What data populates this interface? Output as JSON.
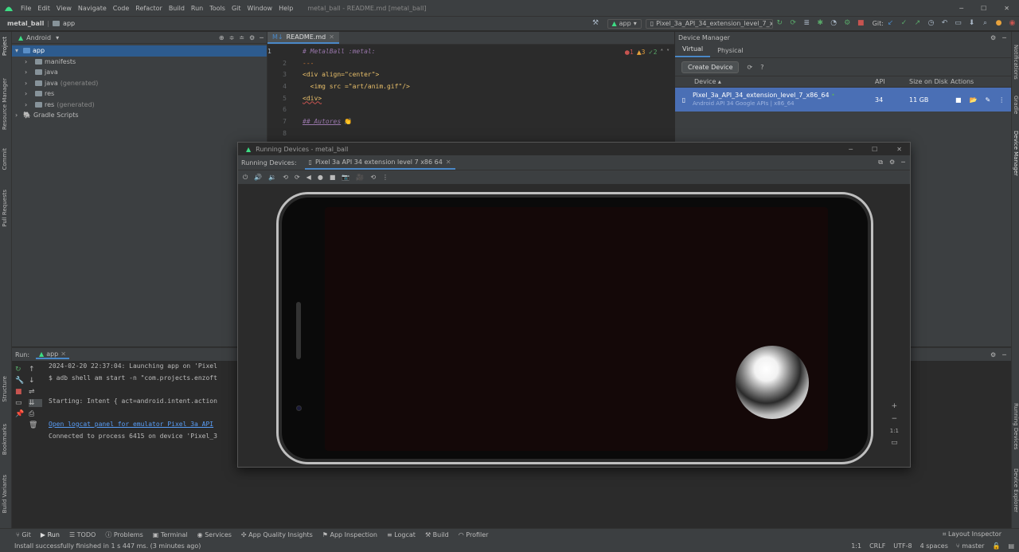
{
  "menu": [
    "File",
    "Edit",
    "View",
    "Navigate",
    "Code",
    "Refactor",
    "Build",
    "Run",
    "Tools",
    "Git",
    "Window",
    "Help"
  ],
  "window_title": "metal_ball - README.md [metal_ball]",
  "breadcrumb": {
    "project": "metal_ball",
    "module": "app"
  },
  "toolbar": {
    "run_config": "app",
    "device": "Pixel_3a_API_34_extension_level_7_x86",
    "git_label": "Git:"
  },
  "project_panel": {
    "view_mode": "Android",
    "tree": [
      {
        "label": "app",
        "level": 0,
        "selected": true
      },
      {
        "label": "manifests",
        "level": 1
      },
      {
        "label": "java",
        "level": 1
      },
      {
        "label": "java",
        "suffix": "(generated)",
        "level": 1
      },
      {
        "label": "res",
        "level": 1
      },
      {
        "label": "res",
        "suffix": "(generated)",
        "level": 1
      },
      {
        "label": "Gradle Scripts",
        "level": 0
      }
    ]
  },
  "left_strip": [
    "Project",
    "Resource Manager",
    "Commit",
    "Pull Requests",
    "Structure",
    "Bookmarks",
    "Build Variants"
  ],
  "right_strip": [
    "Notifications",
    "Gradle",
    "Device Manager",
    "Running Devices",
    "Device Explorer"
  ],
  "editor": {
    "tab": "README.md",
    "inspections": {
      "errors": "1",
      "warnings": "3",
      "ok": "2"
    },
    "lines": [
      {
        "n": "1",
        "text": "# MetalBall :metal:"
      },
      {
        "n": "2",
        "text": "---"
      },
      {
        "n": "3",
        "text": "<div align=\"center\">"
      },
      {
        "n": "4",
        "text": "  <img src =\"art/anim.gif\"/>"
      },
      {
        "n": "5",
        "text": "<div>"
      },
      {
        "n": "6",
        "text": ""
      },
      {
        "n": "7",
        "text": "## Autores"
      },
      {
        "n": "8",
        "text": ""
      }
    ]
  },
  "device_manager": {
    "title": "Device Manager",
    "tabs": [
      "Virtual",
      "Physical"
    ],
    "create_button": "Create Device",
    "help": "?",
    "columns": [
      "Device",
      "API",
      "Size on Disk",
      "Actions"
    ],
    "device": {
      "name": "Pixel_3a_API_34_extension_level_7_x86_64",
      "subtitle": "Android API 34 Google APIs | x86_64",
      "api": "34",
      "size": "11 GB"
    }
  },
  "running_devices": {
    "title": "Running Devices - metal_ball",
    "label": "Running Devices:",
    "tab": "Pixel 3a API 34 extension level 7 x86 64",
    "zoom_label": "1:1"
  },
  "run_panel": {
    "label": "Run:",
    "tab": "app",
    "log": [
      {
        "text": "2024-02-20 22:37:04: Launching app on 'Pixel",
        "link": false
      },
      {
        "text": "$ adb shell am start -n \"com.projects.enzoft",
        "link": false
      },
      {
        "text": "",
        "link": false
      },
      {
        "text": "Starting: Intent { act=android.intent.action",
        "link": false
      },
      {
        "text": "",
        "link": false
      },
      {
        "text": "Open logcat panel for emulator Pixel 3a API",
        "link": true
      },
      {
        "text": "Connected to process 6415 on device 'Pixel_3",
        "link": false
      }
    ]
  },
  "bottom_tabs": [
    "Git",
    "Run",
    "TODO",
    "Problems",
    "Terminal",
    "Services",
    "App Quality Insights",
    "App Inspection",
    "Logcat",
    "Build",
    "Profiler"
  ],
  "layout_inspector": "Layout Inspector",
  "status": {
    "message": "Install successfully finished in 1 s 447 ms. (3 minutes ago)",
    "position": "1:1",
    "line_sep": "CRLF",
    "encoding": "UTF-8",
    "indent": "4 spaces",
    "branch": "master"
  },
  "colors": {
    "accent": "#4a88c7",
    "android_green": "#3ddc84",
    "stop_red": "#c75450"
  }
}
